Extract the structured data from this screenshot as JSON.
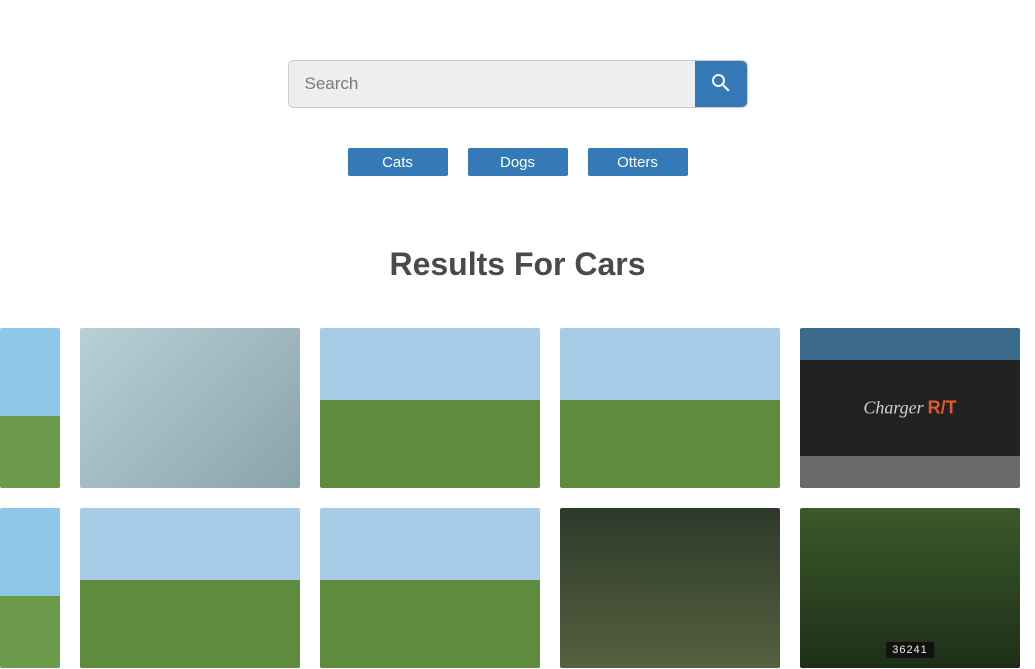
{
  "search": {
    "placeholder": "Search",
    "value": ""
  },
  "pills": [
    {
      "label": "Cats"
    },
    {
      "label": "Dogs"
    },
    {
      "label": "Otters"
    }
  ],
  "results": {
    "title": "Results For Cars",
    "badge_text": "Charger",
    "badge_suffix": "R/T",
    "plate_text": "36241"
  }
}
